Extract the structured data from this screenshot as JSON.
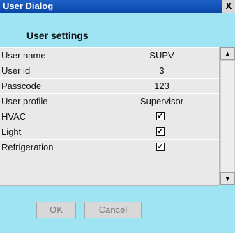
{
  "window": {
    "title": "User Dialog",
    "close_label": "X"
  },
  "section": {
    "title": "User settings"
  },
  "fields": [
    {
      "label": "User name",
      "value": "SUPV"
    },
    {
      "label": "User id",
      "value": "3"
    },
    {
      "label": "Passcode",
      "value": "123"
    },
    {
      "label": "User profile",
      "value": "Supervisor"
    },
    {
      "label": "HVAC",
      "checked": true
    },
    {
      "label": "Light",
      "checked": true
    },
    {
      "label": "Refrigeration",
      "checked": true
    }
  ],
  "check_glyph": "✓",
  "scroll": {
    "up_glyph": "▲",
    "down_glyph": "▼"
  },
  "buttons": {
    "ok": "OK",
    "cancel": "Cancel"
  },
  "colors": {
    "background": "#9fe4f2",
    "titlebar": "#0b46a8",
    "table_bg": "#e9e9e9",
    "button_bg": "#d8d8d8"
  }
}
